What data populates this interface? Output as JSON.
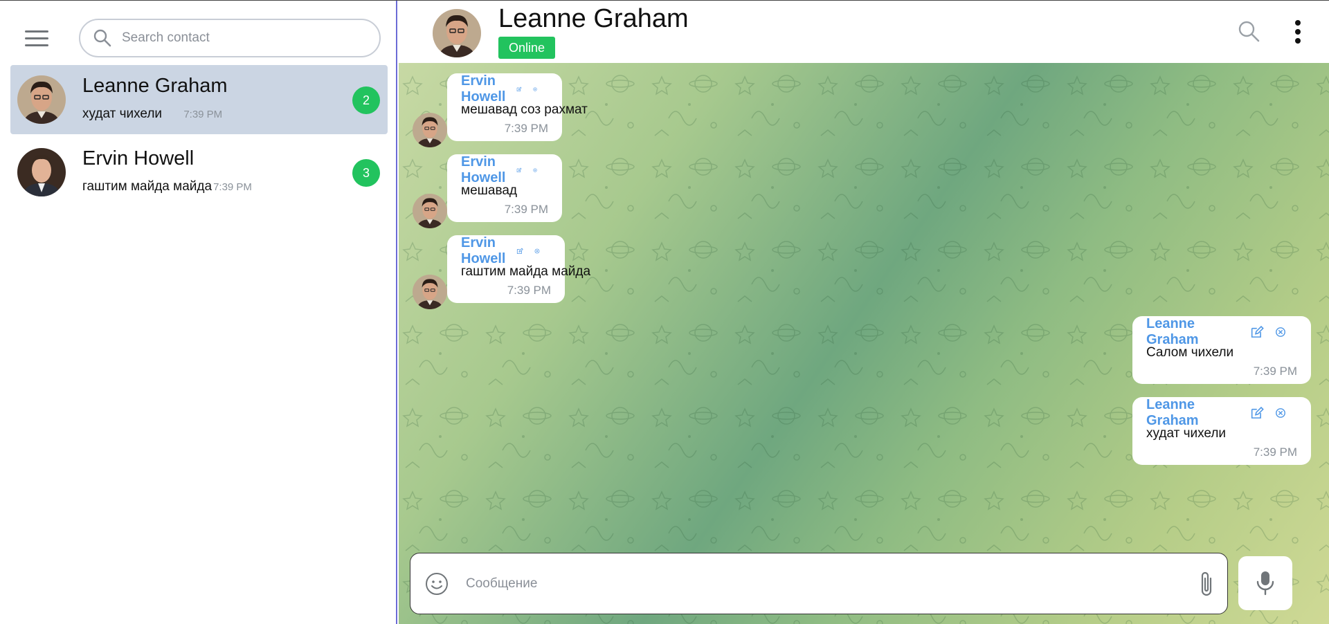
{
  "sidebar": {
    "menu_icon": "hamburger-icon",
    "search": {
      "placeholder": "Search contact",
      "value": "",
      "icon": "search-icon"
    },
    "contacts": [
      {
        "name": "Leanne Graham",
        "last_message": "худат чихели",
        "time": "7:39 PM",
        "unread": "2",
        "active": true
      },
      {
        "name": "Ervin Howell",
        "last_message": "гаштим майда майда",
        "time": "7:39 PM",
        "unread": "3",
        "active": false
      }
    ]
  },
  "chat": {
    "title": "Leanne Graham",
    "status": "Online",
    "header_icons": [
      "search-icon",
      "more-vertical-icon"
    ],
    "messages": [
      {
        "author": "Ervin Howell",
        "text": "мешавад соз рахмат",
        "time": "7:39 PM",
        "side": "incoming"
      },
      {
        "author": "Ervin Howell",
        "text": "мешавад",
        "time": "7:39 PM",
        "side": "incoming"
      },
      {
        "author": "Ervin Howell",
        "text": "гаштим майда майда",
        "time": "7:39 PM",
        "side": "incoming"
      },
      {
        "author": "Leanne Graham",
        "text": "Салом чихели",
        "time": "7:39 PM",
        "side": "outgoing"
      },
      {
        "author": "Leanne Graham",
        "text": "худат чихели",
        "time": "7:39 PM",
        "side": "outgoing"
      }
    ],
    "composer": {
      "placeholder": "Сообщение",
      "value": "",
      "icons": [
        "emoji-icon",
        "paperclip-icon",
        "microphone-icon"
      ]
    }
  },
  "colors": {
    "accent_green": "#22c35e",
    "author_blue": "#4f97e6",
    "active_row": "#cbd5e3",
    "divider": "#6b6bd6"
  }
}
